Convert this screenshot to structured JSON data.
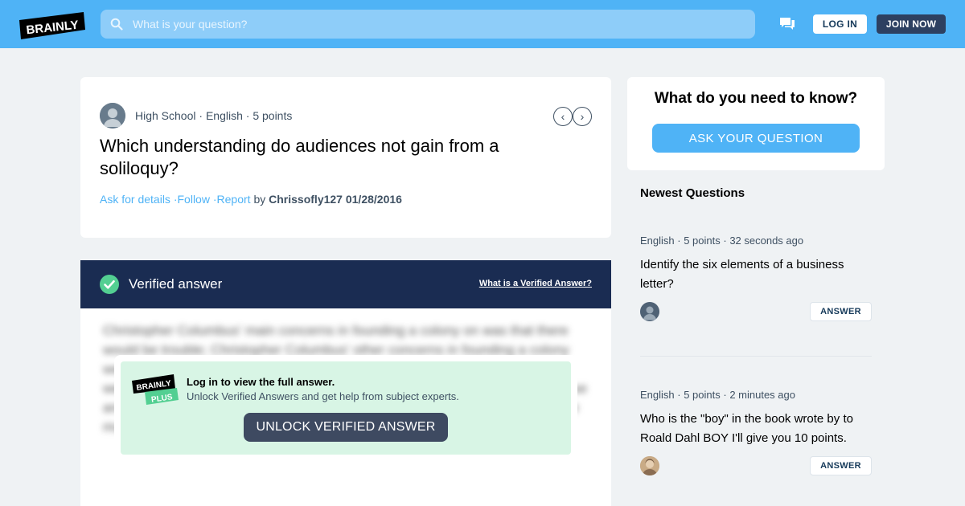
{
  "header": {
    "logo_text": "BRAINLY",
    "search_placeholder": "What is your question?",
    "login_label": "LOG IN",
    "join_label": "JOIN NOW"
  },
  "question": {
    "level": "High School",
    "subject": "English",
    "points": "5 points",
    "title": "Which understanding do audiences not gain from a soliloquy?",
    "ask_details": "Ask for details",
    "follow": "Follow",
    "report": "Report",
    "by_label": "by",
    "author": "Chrissofly127",
    "date": "01/28/2016"
  },
  "verified": {
    "title": "Verified answer",
    "what_link": "What is a Verified Answer?",
    "blurred_text": "Christopher Columbus' main concerns in founding a colony on was that there would be trouble; Christopher Columbus' other concerns in founding a colony were that the land would be poor and the settlers would not be able to farm it well and that the natives would attack them; the settlers would also face disease and a lack of supplies and would need help; concerns of founding a colony; we must find land; better for Native, Christopher Columbus' main concerns.",
    "lock_title": "Log in to view the full answer.",
    "lock_subtitle": "Unlock Verified Answers and get help from subject experts.",
    "unlock_label": "UNLOCK VERIFIED ANSWER",
    "plus_logo_top": "BRAINLY",
    "plus_logo_bottom": "PLUS"
  },
  "sidebar": {
    "ask_title": "What do you need to know?",
    "ask_button": "ASK YOUR QUESTION",
    "newest_title": "Newest Questions",
    "questions": [
      {
        "subject": "English",
        "points": "5 points",
        "time": "32 seconds ago",
        "text": "Identify the six elements of a business letter?",
        "answer_label": "ANSWER"
      },
      {
        "subject": "English",
        "points": "5 points",
        "time": "2 minutes ago",
        "text": "Who is the \"boy\" in the book wrote by to Roald Dahl BOY I'll give you 10 points.",
        "answer_label": "ANSWER"
      }
    ]
  },
  "colors": {
    "brand_blue": "#4fb3f6",
    "navy": "#1a2c52",
    "verified_green": "#53cf92",
    "lock_bg": "#d8f5e5"
  }
}
